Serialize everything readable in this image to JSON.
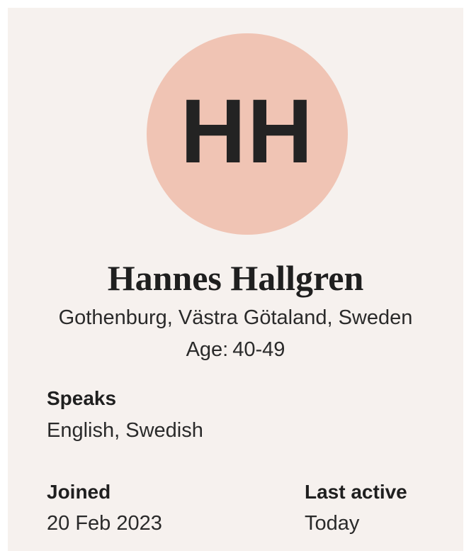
{
  "profile": {
    "initials": "HH",
    "name": "Hannes Hallgren",
    "location": "Gothenburg, Västra Götaland, Sweden",
    "age_label": "Age:",
    "age_value": "40-49",
    "avatar_color": "#f0c4b4",
    "background_color": "#f6f1ee"
  },
  "details": {
    "speaks_label": "Speaks",
    "speaks_value": "English, Swedish",
    "joined_label": "Joined",
    "joined_value": "20 Feb 2023",
    "last_active_label": "Last active",
    "last_active_value": "Today"
  }
}
